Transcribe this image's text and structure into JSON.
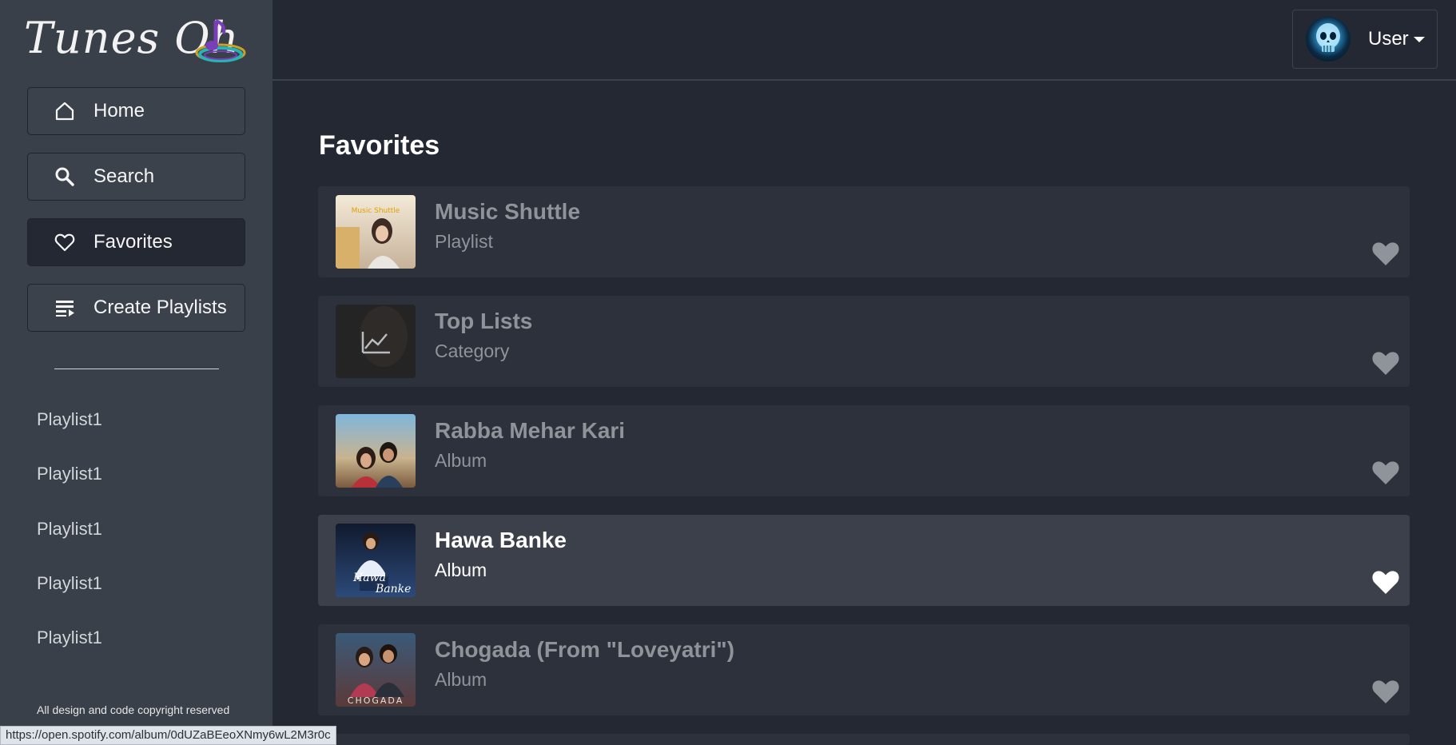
{
  "app": {
    "logo_text": "Tunes Oh"
  },
  "nav": [
    {
      "label": "Home",
      "icon": "home-icon"
    },
    {
      "label": "Search",
      "icon": "search-icon"
    },
    {
      "label": "Favorites",
      "icon": "heart-icon",
      "active": true
    },
    {
      "label": "Create Playlists",
      "icon": "playlist-icon"
    }
  ],
  "playlists": [
    "Playlist1",
    "Playlist1",
    "Playlist1",
    "Playlist1",
    "Playlist1"
  ],
  "footer": {
    "copyright": "All design and code copyright reserved"
  },
  "user": {
    "label": "User"
  },
  "main": {
    "title": "Favorites",
    "items": [
      {
        "title": "Music Shuttle",
        "type": "Playlist",
        "thumb_label": "Music Shuttle"
      },
      {
        "title": "Top Lists",
        "type": "Category"
      },
      {
        "title": "Rabba Mehar Kari",
        "type": "Album"
      },
      {
        "title": "Hawa Banke",
        "type": "Album",
        "highlighted": true
      },
      {
        "title": "Chogada (From \"Loveyatri\")",
        "type": "Album",
        "thumb_label": "CHOGADA"
      }
    ]
  },
  "status_bar": {
    "url": "https://open.spotify.com/album/0dUZaBEeoXNmy6wL2M3r0c"
  },
  "colors": {
    "sidebar": "#394049",
    "background": "#232833",
    "card": "#2c313b",
    "card_highlight": "#3b404a",
    "muted_text": "#8f939a"
  }
}
